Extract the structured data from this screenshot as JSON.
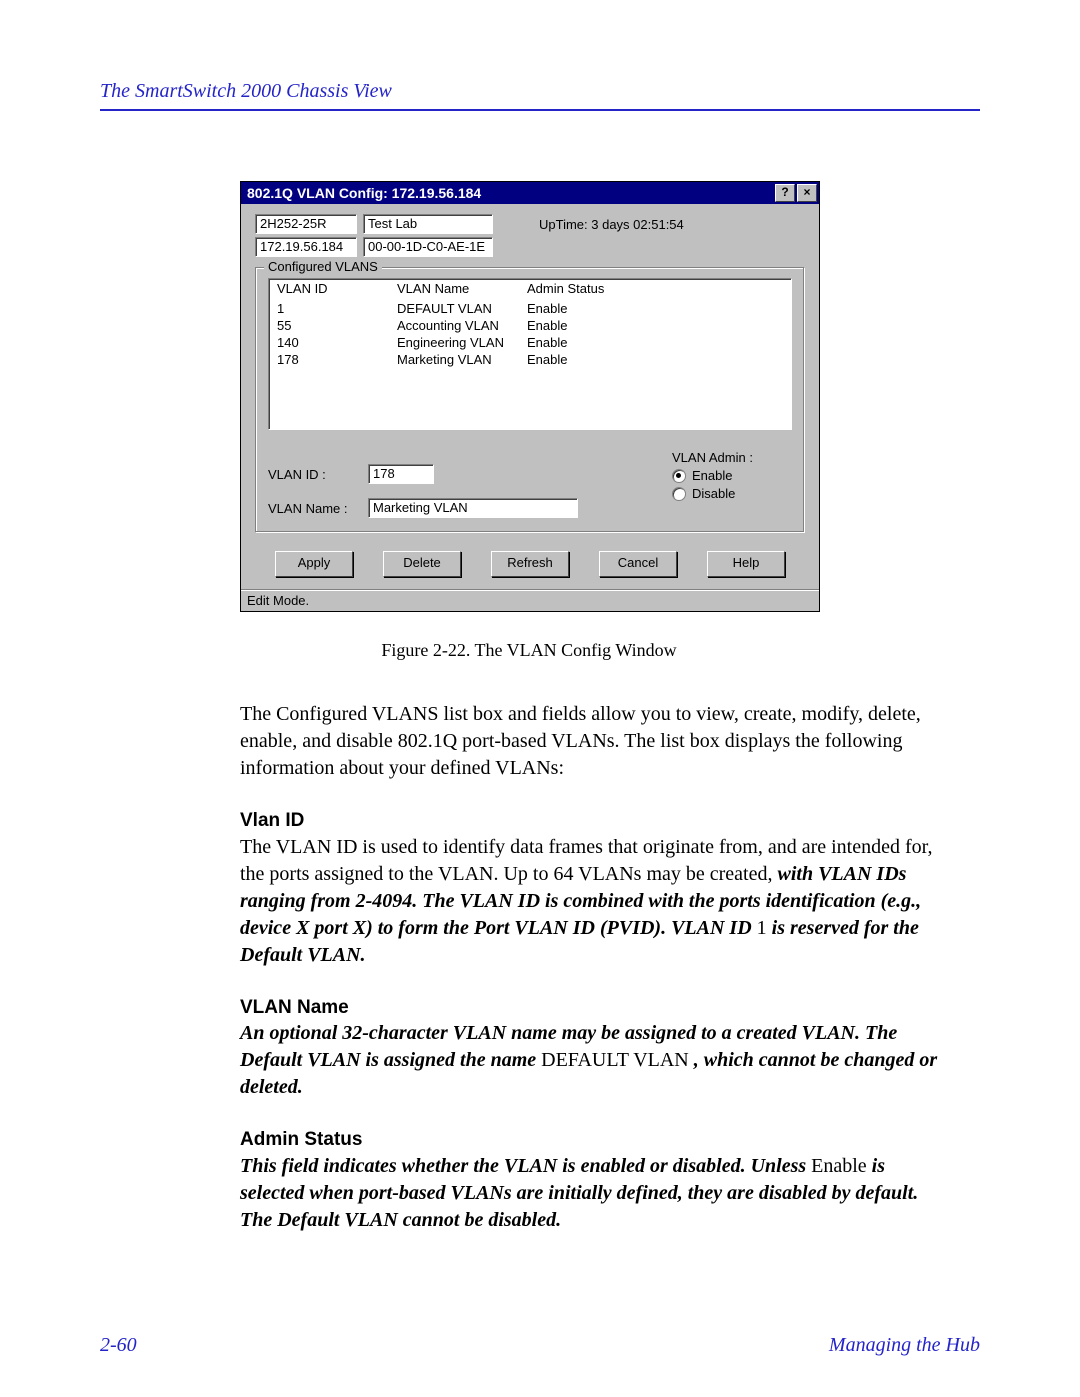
{
  "header": {
    "title": "The SmartSwitch 2000 Chassis View"
  },
  "dialog": {
    "title": "802.1Q VLAN Config: 172.19.56.184",
    "device_name": "2H252-25R",
    "location": "Test Lab",
    "ip": "172.19.56.184",
    "mac": "00-00-1D-C0-AE-1E",
    "uptime": "UpTime: 3 days 02:51:54",
    "group_label": "Configured VLANS",
    "columns": {
      "id": "VLAN ID",
      "name": "VLAN Name",
      "status": "Admin Status"
    },
    "rows": [
      {
        "id": "1",
        "name": "DEFAULT VLAN",
        "status": "Enable"
      },
      {
        "id": "55",
        "name": "Accounting VLAN",
        "status": "Enable"
      },
      {
        "id": "140",
        "name": "Engineering VLAN",
        "status": "Enable"
      },
      {
        "id": "178",
        "name": "Marketing VLAN",
        "status": "Enable"
      }
    ],
    "form": {
      "vlan_id_label": "VLAN ID :",
      "vlan_id_value": "178",
      "vlan_name_label": "VLAN Name :",
      "vlan_name_value": "Marketing VLAN",
      "admin_label": "VLAN Admin :",
      "enable_label": "Enable",
      "disable_label": "Disable",
      "admin_selected": "enable"
    },
    "buttons": {
      "apply": "Apply",
      "delete": "Delete",
      "refresh": "Refresh",
      "cancel": "Cancel",
      "help": "Help"
    },
    "statusbar": "Edit Mode."
  },
  "caption": "Figure 2-22.  The VLAN Config Window",
  "paragraphs": {
    "intro": "The Configured VLANS  list box and fields allow you to view, create, modify, delete, enable, and disable 802.1Q port-based VLANs. The list box displays the following information about your defined VLANs:",
    "vlan_id_h": "Vlan ID",
    "vlan_id_p1": "The VLAN ID is used to identify data frames that originate from, and are intended for, the ports assigned to the VLAN. Up to 64 VLANs may be created, ",
    "vlan_id_p2": "with VLAN IDs ranging from 2-4094. The VLAN ID is combined with the ports identification (e.g., device X port X) to form the Port VLAN ID (PVID). VLAN ID ",
    "vlan_id_p3_num": "1",
    "vlan_id_p3_rest": " is reserved for the Default VLAN.",
    "vlan_name_h": "VLAN Name",
    "vlan_name_p1": "An optional 32-character VLAN name may be assigned to a created VLAN. The Default VLAN is assigned the name ",
    "vlan_name_p1_mid": "DEFAULT VLAN",
    "vlan_name_p1_end": ", which cannot be changed or deleted.",
    "admin_h": "Admin Status",
    "admin_p1": "This field indicates whether the VLAN is enabled or disabled. Unless ",
    "admin_mid": "Enable",
    "admin_p2": " is selected when port-based VLANs are initially defined, they are disabled by default. The Default VLAN cannot be disabled."
  },
  "footer": {
    "left": "2-60",
    "right": "Managing the Hub"
  }
}
